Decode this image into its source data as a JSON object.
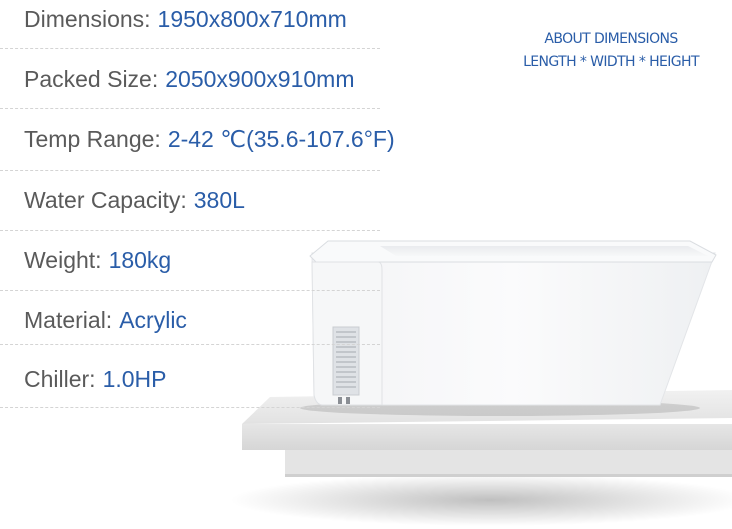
{
  "specs": [
    {
      "label": "Dimensions:",
      "value": "1950x800x710mm"
    },
    {
      "label": "Packed Size:",
      "value": "2050x900x910mm"
    },
    {
      "label": "Temp Range:",
      "value": "2-42 ℃(35.6-107.6°F)"
    },
    {
      "label": "Water Capacity:",
      "value": "380L"
    },
    {
      "label": "Weight:",
      "value": "180kg"
    },
    {
      "label": "Material:",
      "value": "Acrylic"
    },
    {
      "label": "Chiller:",
      "value": "1.0HP"
    }
  ],
  "about": {
    "line1": "ABOUT DIMENSIONS",
    "line2": "LENGTH * WIDTH * HEIGHT"
  },
  "colors": {
    "label": "#5a5a5a",
    "value": "#2a5da8",
    "accent": "#2a5da8"
  }
}
